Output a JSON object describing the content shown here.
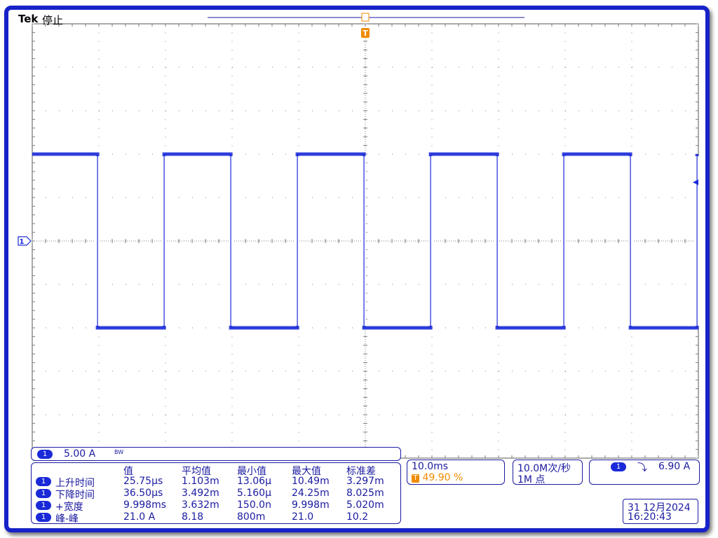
{
  "header": {
    "brand": "Tek",
    "status": "停止"
  },
  "markers": {
    "trigger_letter": "T",
    "channel_ref": "1"
  },
  "colors": {
    "trace": "#1a2ad8",
    "text": "#1a1aa0",
    "trigger": "#f08a00",
    "frame": "#1722c8",
    "grid": "#7f7f7f"
  },
  "chart_data": {
    "type": "line",
    "title": "",
    "xlabel": "",
    "ylabel": "",
    "divisions": {
      "x": 10,
      "y": 10
    },
    "time_per_div_ms": 10.0,
    "amps_per_div": 5.0,
    "x_range_ms": [
      0,
      100
    ],
    "y_range_div": [
      -5,
      5
    ],
    "grid": true,
    "series": [
      {
        "name": "",
        "x_ms": [
          0,
          9.8,
          9.8,
          19.8,
          19.8,
          29.8,
          29.8,
          39.8,
          39.8,
          49.8,
          49.8,
          59.8,
          59.8,
          69.8,
          69.8,
          79.8,
          79.8,
          89.8,
          89.8,
          99.8,
          99.8
        ],
        "y_div": [
          2.0,
          2.0,
          -2.0,
          -2.0,
          2.0,
          2.0,
          -2.0,
          -2.0,
          2.0,
          2.0,
          -2.0,
          -2.0,
          2.0,
          2.0,
          -2.0,
          -2.0,
          2.0,
          2.0,
          -2.0,
          -2.0,
          2.0
        ]
      }
    ],
    "trigger_level_div": 1.35
  },
  "channel_bar": {
    "channel": "1",
    "scale": "5.00 A",
    "bw": "BW"
  },
  "measurements": {
    "headers": [
      "值",
      "平均值",
      "最小值",
      "最大值",
      "标准差"
    ],
    "rows": [
      {
        "ch": "1",
        "name": "上升时间",
        "values": [
          "25.75µs",
          "1.103m",
          "13.06µ",
          "10.49m",
          "3.297m"
        ]
      },
      {
        "ch": "1",
        "name": "下降时间",
        "values": [
          "36.50µs",
          "3.492m",
          "5.160µ",
          "24.25m",
          "8.025m"
        ]
      },
      {
        "ch": "1",
        "name": "+宽度",
        "values": [
          "9.998ms",
          "3.632m",
          "150.0n",
          "9.998m",
          "5.020m"
        ]
      },
      {
        "ch": "1",
        "name": "峰-峰",
        "values": [
          "21.0 A",
          "8.18",
          "800m",
          "21.0",
          "10.2"
        ]
      }
    ]
  },
  "horizontal": {
    "timebase": "10.0ms",
    "trigger_pos_icon": "T",
    "trigger_pos": "49.90 %"
  },
  "acquisition": {
    "rate": "10.0M次/秒",
    "points": "1M 点"
  },
  "trigger_info": {
    "channel": "1",
    "slope_icon": "falling-edge-icon",
    "slope_glyph": "⤵",
    "level": "6.90 A"
  },
  "datetime": {
    "date": "31 12月2024",
    "time": "16:20:43"
  }
}
